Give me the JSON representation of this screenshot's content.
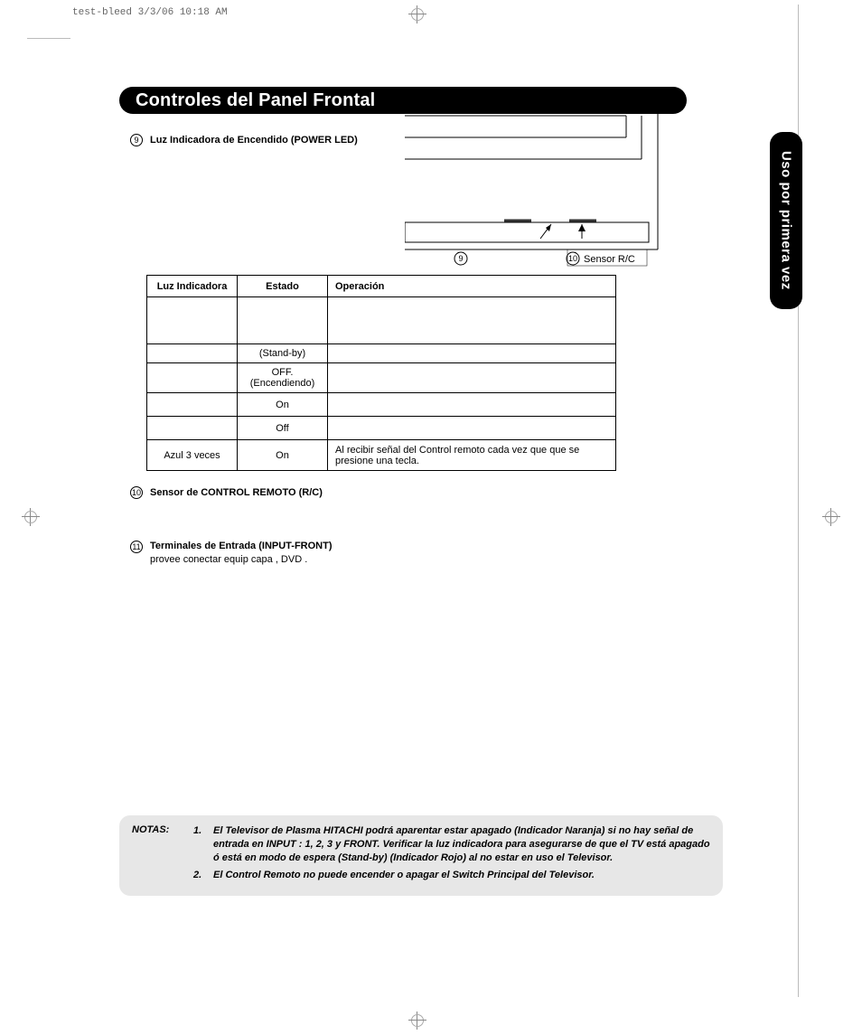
{
  "meta": {
    "header": "test-bleed  3/3/06  10:18 AM"
  },
  "title": "Controles del Panel Frontal",
  "sidetab": "Uso por primera vez",
  "item9": {
    "num": "9",
    "label": "Luz Indicadora de Encendido (POWER LED)"
  },
  "diagram": {
    "call9": "9",
    "call10": "10",
    "sensor": "Sensor R/C"
  },
  "table": {
    "h1": "Luz Indicadora",
    "h2": "Estado",
    "h3": "Operación",
    "rows": [
      {
        "luz": "",
        "est": "",
        "op": ""
      },
      {
        "luz": "",
        "est": "(Stand-by)",
        "op": ""
      },
      {
        "luz": "",
        "est": "OFF. (Encendiendo)",
        "op": ""
      },
      {
        "luz": "",
        "est": "On",
        "op": ""
      },
      {
        "luz": "",
        "est": "Off",
        "op": ""
      },
      {
        "luz": "Azul 3 veces",
        "est": "On",
        "op": "Al recibir señal del Control remoto cada vez que que se presione una tecla."
      }
    ]
  },
  "item10": {
    "num": "10",
    "label": "Sensor de CONTROL REMOTO (R/C)"
  },
  "item11": {
    "num": "11",
    "label": "Terminales de Entrada  (INPUT-FRONT)",
    "body": "provee conectar equip capa , DVD ."
  },
  "notes": {
    "label": "NOTAS:",
    "n1num": "1.",
    "n1": "El Televisor de Plasma HITACHI podrá aparentar estar apagado (Indicador Naranja) si no hay señal de entrada en INPUT : 1, 2, 3 y FRONT.  Verificar la luz indicadora para asegurarse de que el TV está apagado ó está en modo de espera (Stand-by) (Indicador Rojo) al no estar en uso el Televisor.",
    "n2num": "2.",
    "n2": "El Control Remoto no puede encender o apagar el Switch Principal del Televisor."
  }
}
